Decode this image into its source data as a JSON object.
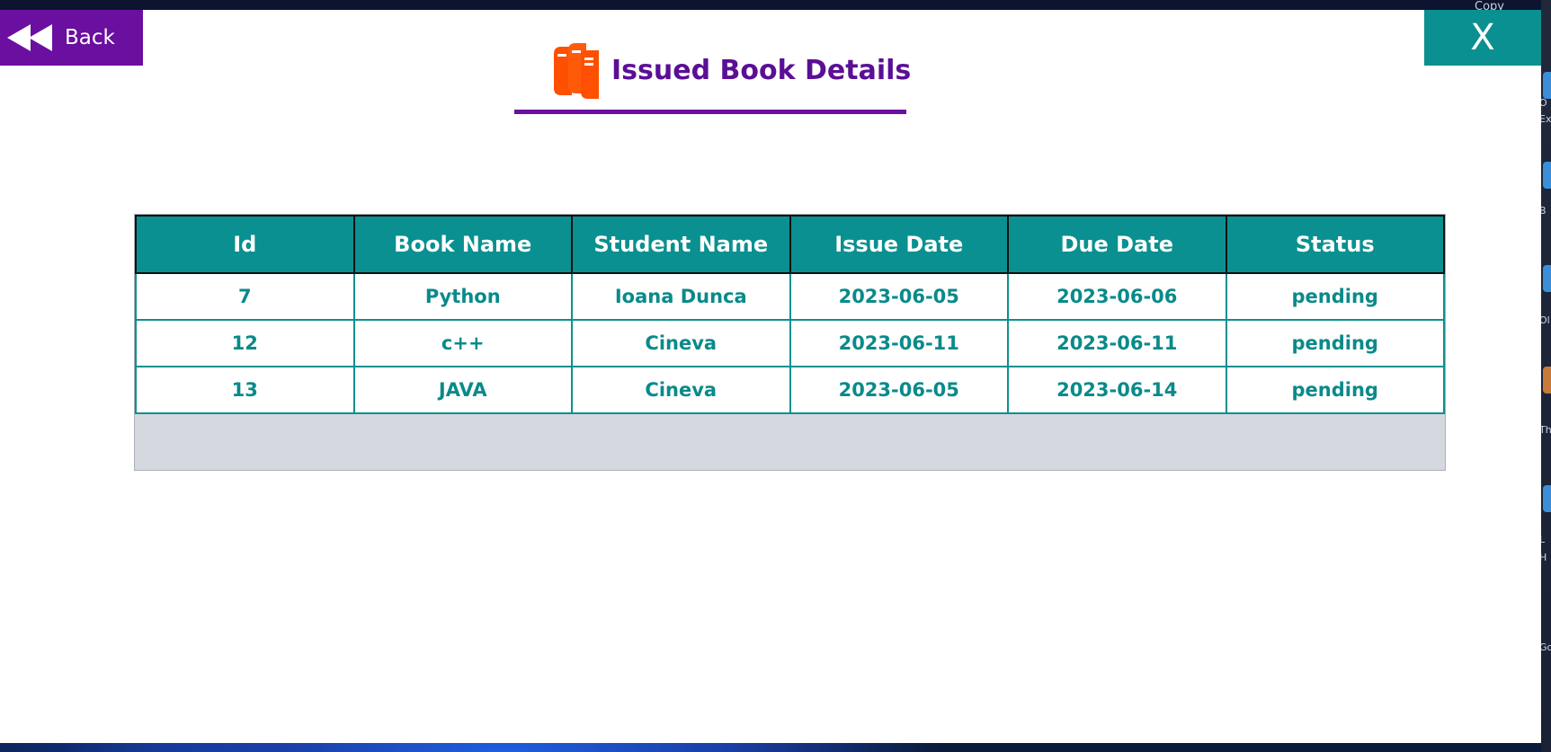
{
  "desktop": {
    "top_right_label": "Copy",
    "side_labels": [
      "O",
      "Ex",
      "B",
      "Ol",
      "Th",
      "L",
      "H",
      "Go"
    ]
  },
  "window": {
    "back_label": "Back",
    "close_label": "X",
    "title": "Issued Book Details"
  },
  "table": {
    "columns": [
      "Id",
      "Book Name",
      "Student Name",
      "Issue Date",
      "Due Date",
      "Status"
    ],
    "rows": [
      [
        "7",
        "Python",
        "Ioana Dunca",
        "2023-06-05",
        "2023-06-06",
        "pending"
      ],
      [
        "12",
        "c++",
        "Cineva",
        "2023-06-11",
        "2023-06-11",
        "pending"
      ],
      [
        "13",
        "JAVA",
        "Cineva",
        "2023-06-05",
        "2023-06-14",
        "pending"
      ]
    ]
  },
  "colors": {
    "accent_purple": "#6a0fa0",
    "accent_teal": "#0a9090",
    "title_text": "#5a0f96",
    "icon_orange": "#ff4f00"
  },
  "icons": {
    "back": "rewind-icon",
    "title": "books-icon"
  }
}
